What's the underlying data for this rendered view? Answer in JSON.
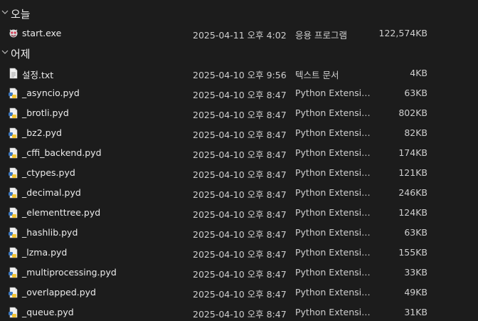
{
  "groups": [
    {
      "title": "오늘",
      "items": [
        {
          "name": "start.exe",
          "date": "2025-04-11 오후 4:02",
          "type": "응용 프로그램",
          "size": "122,574KB",
          "icon": "exe-icon"
        }
      ]
    },
    {
      "title": "어제",
      "items": [
        {
          "name": "설정.txt",
          "date": "2025-04-10 오후 9:56",
          "type": "텍스트 문서",
          "size": "4KB",
          "icon": "text-file-icon"
        },
        {
          "name": "_asyncio.pyd",
          "date": "2025-04-10 오후 8:47",
          "type": "Python Extension",
          "size": "63KB",
          "icon": "python-file-icon"
        },
        {
          "name": "_brotli.pyd",
          "date": "2025-04-10 오후 8:47",
          "type": "Python Extension",
          "size": "802KB",
          "icon": "python-file-icon"
        },
        {
          "name": "_bz2.pyd",
          "date": "2025-04-10 오후 8:47",
          "type": "Python Extension",
          "size": "82KB",
          "icon": "python-file-icon"
        },
        {
          "name": "_cffi_backend.pyd",
          "date": "2025-04-10 오후 8:47",
          "type": "Python Extension",
          "size": "174KB",
          "icon": "python-file-icon"
        },
        {
          "name": "_ctypes.pyd",
          "date": "2025-04-10 오후 8:47",
          "type": "Python Extension",
          "size": "121KB",
          "icon": "python-file-icon"
        },
        {
          "name": "_decimal.pyd",
          "date": "2025-04-10 오후 8:47",
          "type": "Python Extension",
          "size": "246KB",
          "icon": "python-file-icon"
        },
        {
          "name": "_elementtree.pyd",
          "date": "2025-04-10 오후 8:47",
          "type": "Python Extension",
          "size": "124KB",
          "icon": "python-file-icon"
        },
        {
          "name": "_hashlib.pyd",
          "date": "2025-04-10 오후 8:47",
          "type": "Python Extension",
          "size": "63KB",
          "icon": "python-file-icon"
        },
        {
          "name": "_lzma.pyd",
          "date": "2025-04-10 오후 8:47",
          "type": "Python Extension",
          "size": "155KB",
          "icon": "python-file-icon"
        },
        {
          "name": "_multiprocessing.pyd",
          "date": "2025-04-10 오후 8:47",
          "type": "Python Extension",
          "size": "33KB",
          "icon": "python-file-icon"
        },
        {
          "name": "_overlapped.pyd",
          "date": "2025-04-10 오후 8:47",
          "type": "Python Extension",
          "size": "49KB",
          "icon": "python-file-icon"
        },
        {
          "name": "_queue.pyd",
          "date": "2025-04-10 오후 8:47",
          "type": "Python Extension",
          "size": "31KB",
          "icon": "python-file-icon"
        }
      ]
    }
  ]
}
